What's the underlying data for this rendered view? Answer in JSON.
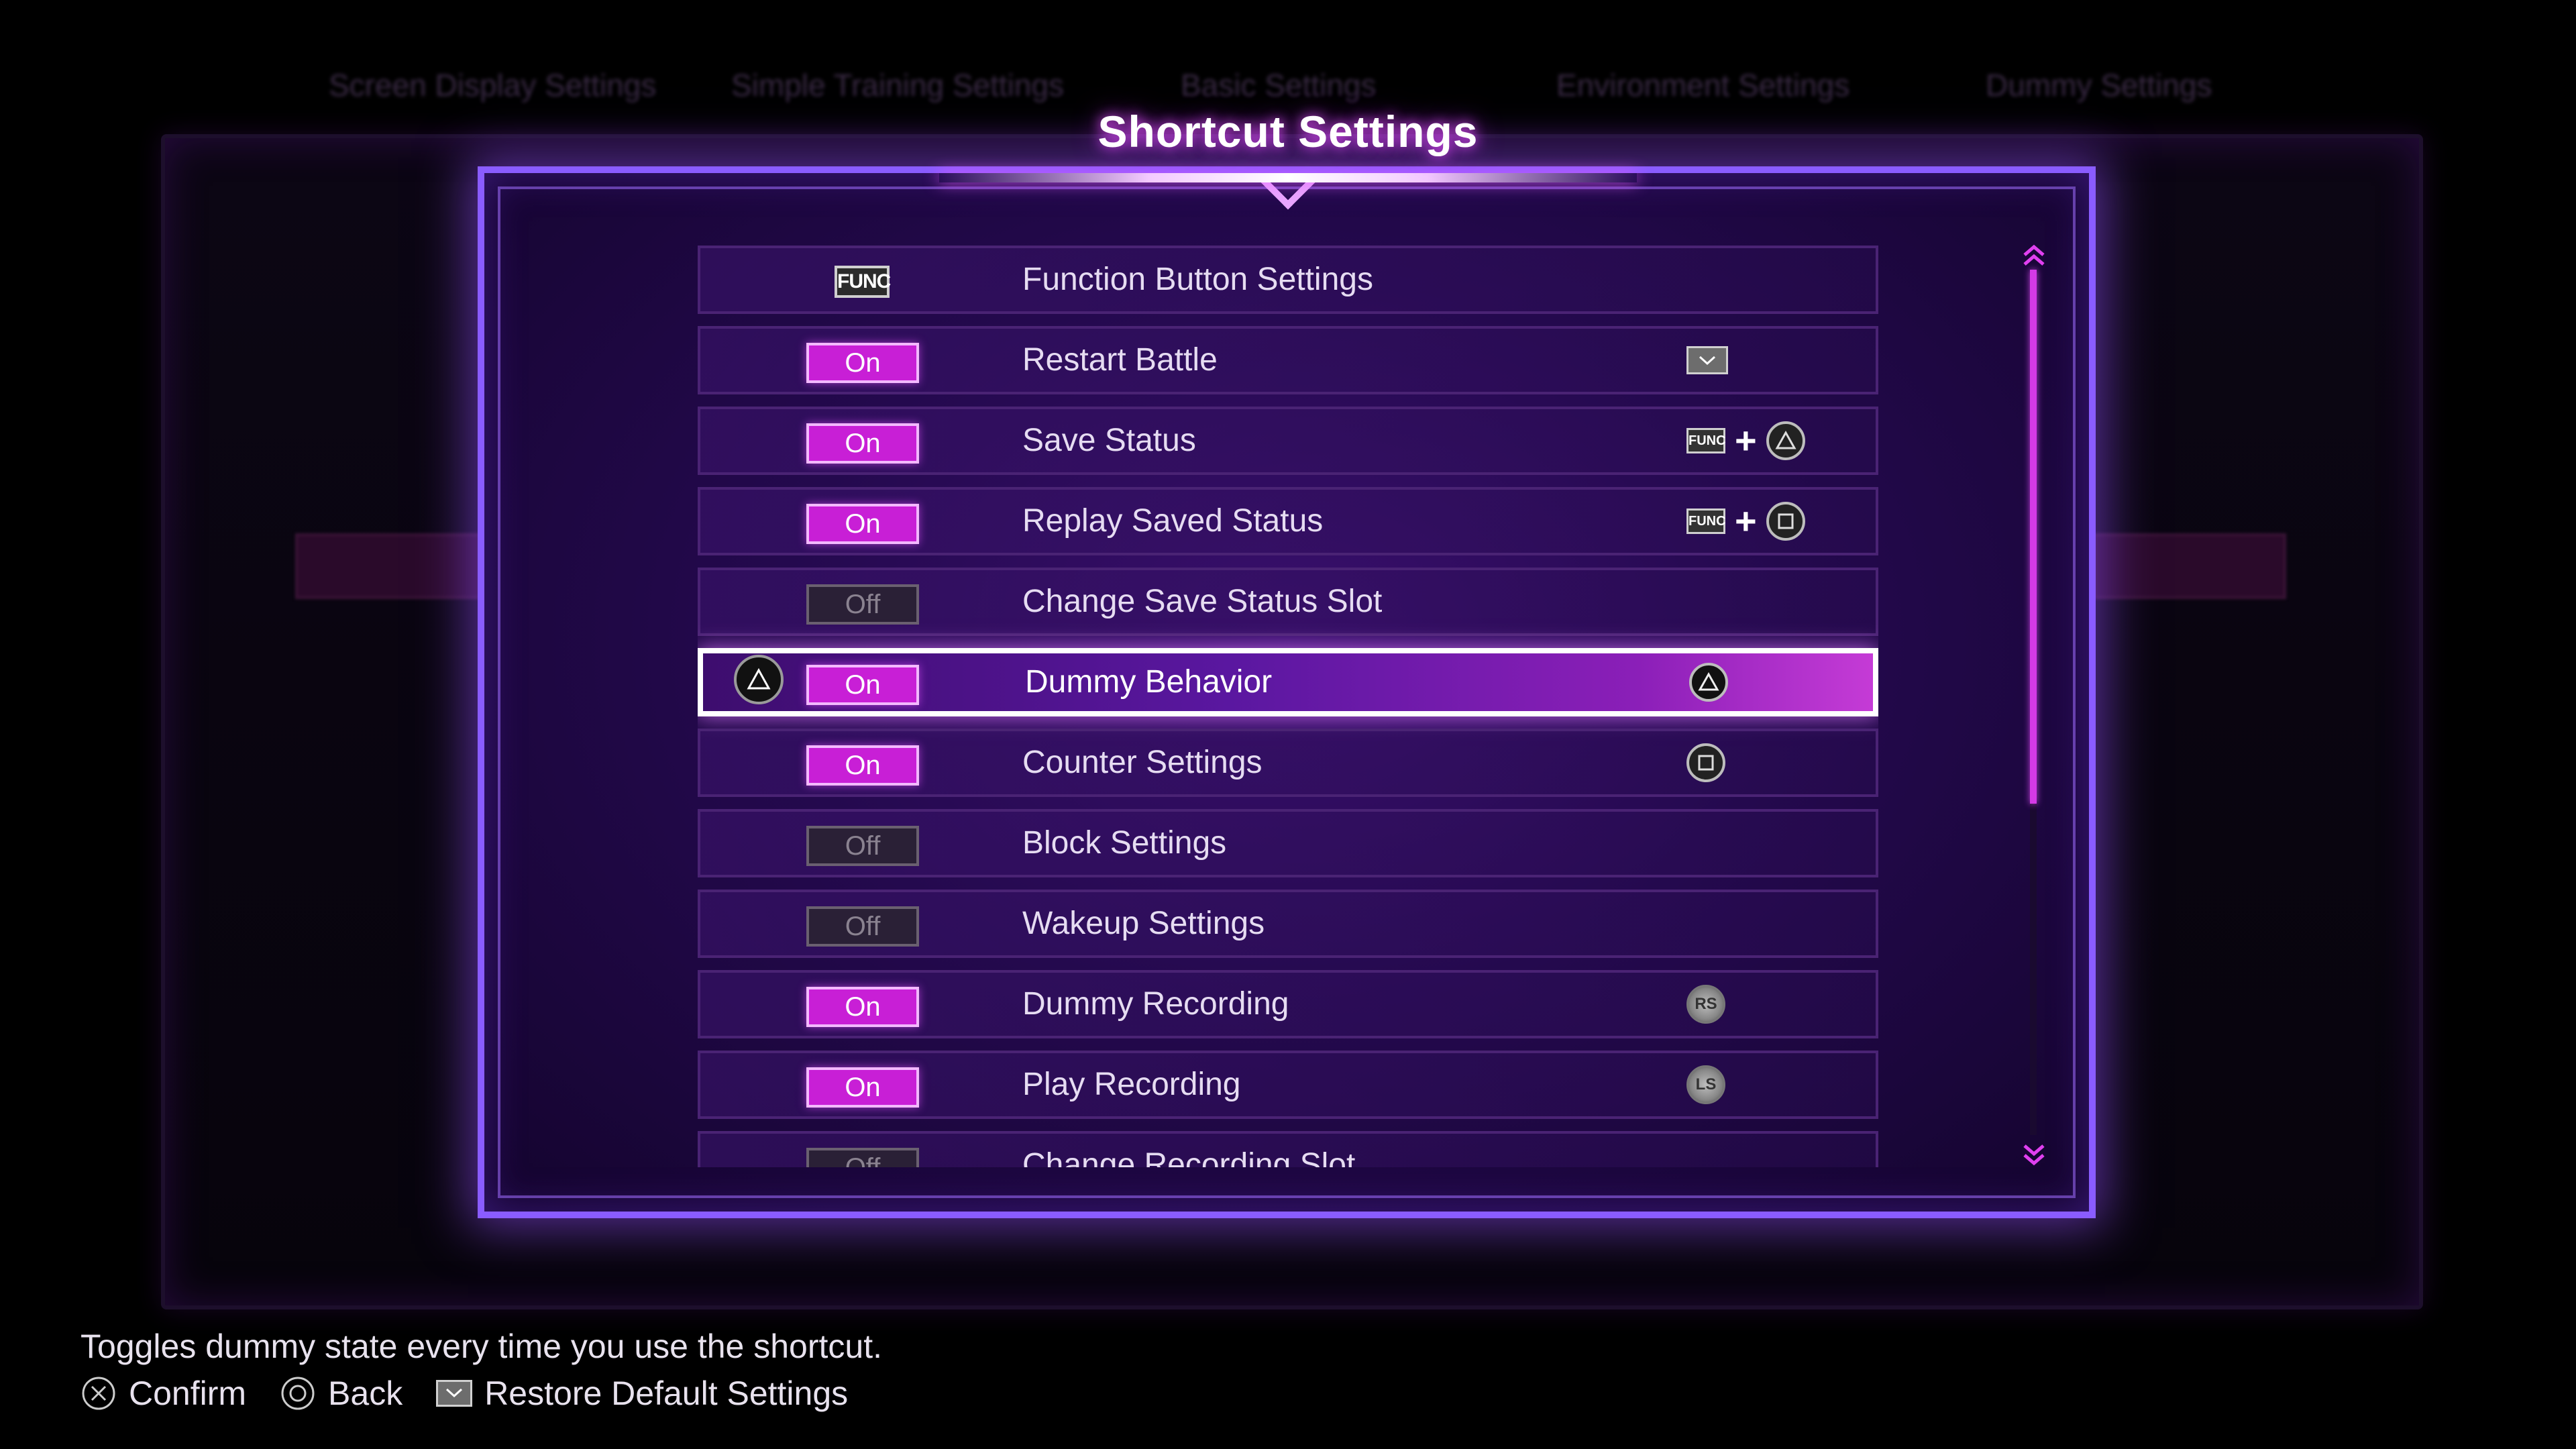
{
  "background_tabs": [
    "Screen Display Settings",
    "Simple Training Settings",
    "Basic Settings",
    "Environment Settings",
    "Dummy Settings"
  ],
  "title": "Shortcut Settings",
  "rows": [
    {
      "label": "Function Button Settings",
      "toggle": null,
      "badge": "FUNC",
      "shortcut": []
    },
    {
      "label": "Restart Battle",
      "toggle": "On",
      "shortcut": [
        "touchpad"
      ]
    },
    {
      "label": "Save Status",
      "toggle": "On",
      "shortcut": [
        "FUNC",
        "+",
        "triangle"
      ]
    },
    {
      "label": "Replay Saved Status",
      "toggle": "On",
      "shortcut": [
        "FUNC",
        "+",
        "square"
      ]
    },
    {
      "label": "Change Save Status Slot",
      "toggle": "Off",
      "shortcut": []
    },
    {
      "label": "Dummy Behavior",
      "toggle": "On",
      "shortcut": [
        "triangle"
      ],
      "selected": true
    },
    {
      "label": "Counter Settings",
      "toggle": "On",
      "shortcut": [
        "square"
      ]
    },
    {
      "label": "Block Settings",
      "toggle": "Off",
      "shortcut": []
    },
    {
      "label": "Wakeup Settings",
      "toggle": "Off",
      "shortcut": []
    },
    {
      "label": "Dummy Recording",
      "toggle": "On",
      "shortcut": [
        "RS"
      ]
    },
    {
      "label": "Play Recording",
      "toggle": "On",
      "shortcut": [
        "LS"
      ]
    },
    {
      "label": "Change Recording Slot",
      "toggle": "Off",
      "shortcut": []
    }
  ],
  "hint": "Toggles dummy state every time you use the shortcut.",
  "footer": {
    "confirm": "Confirm",
    "back": "Back",
    "restore": "Restore Default Settings"
  },
  "icons": {
    "row_selected_prefix": "triangle-icon",
    "scroll_up": "double-chevron-up-icon",
    "scroll_down": "double-chevron-down-icon",
    "confirm": "cross-button-icon",
    "back": "circle-button-icon",
    "restore": "touchpad-icon"
  },
  "colors": {
    "accent": "#c81fd6",
    "panel_border": "#8a5cff",
    "toggle_off": "#2a2036"
  }
}
